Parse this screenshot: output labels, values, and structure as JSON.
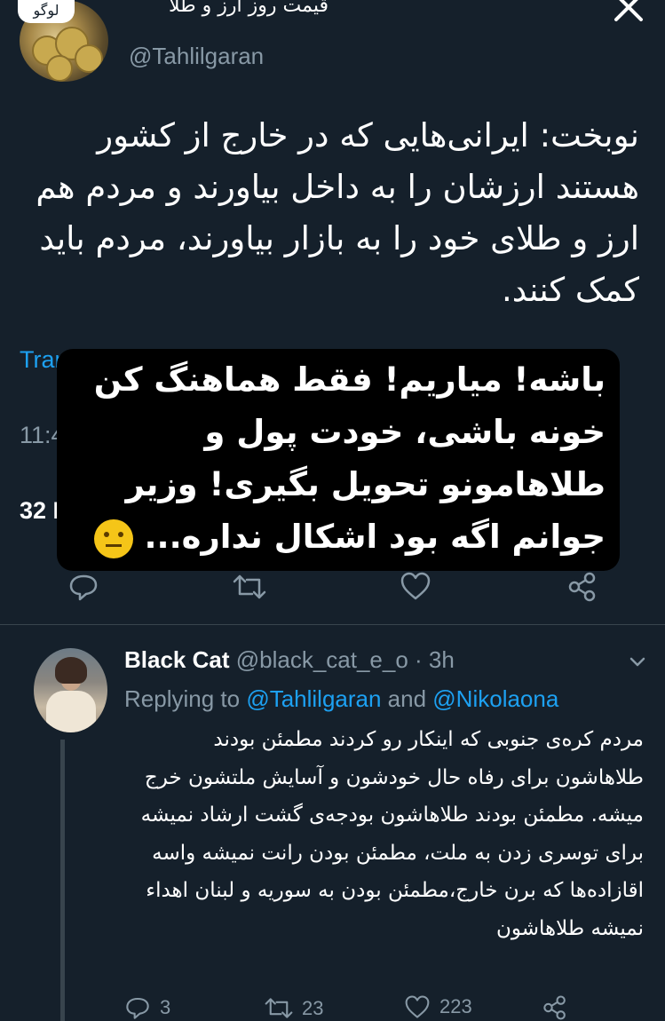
{
  "top_tweet": {
    "sticker": "لوگو",
    "display_name": "قیمت روز ارز و طلا",
    "handle": "@Tahlilgaran",
    "text": "نوبخت: ایرانی‌هایی که در خارج از کشور هستند ارزشان را به داخل بیاورند و مردم هم ارز و طلای خود را به بازار بیاورند، مردم باید کمک کنند.",
    "translate_label": "Tran",
    "time": "11:42 A",
    "retweets": "32 R"
  },
  "overlay_caption": {
    "line1": "باشه! میاریم! فقط هماهنگ کن",
    "line2": "خونه باشی، خودت پول و",
    "line3": "طلاهامونو تحویل بگیری! وزیر",
    "line4": "جوانم اگه بود اشکال نداره..."
  },
  "reply": {
    "display_name": "Black Cat",
    "handle": "@black_cat_e_o",
    "separator": " · ",
    "age": "3h",
    "replying_prefix": "Replying to ",
    "mention_1": "@Tahlilgaran",
    "and_word": " and ",
    "mention_2": "@Nikolaona",
    "text": "مردم کره‌ی جنوبی که اینکار رو کردند مطمئن بودند طلاهاشون برای رفاه حال خودشون و آسایش ملتشون خرج میشه. مطمئن بودند طلاهاشون بودجه‌ی گشت ارشاد نمیشه برای توسری زدن به ملت، مطمئن بودن رانت نمیشه واسه اقازاده‌ها که برن خارج،مطمئن بودن به سوریه و لبنان اهداء نمیشه طلاهاشون",
    "replies": "3",
    "retweets": "23",
    "likes": "223"
  },
  "colors": {
    "background": "#15202b",
    "link": "#1da1f2",
    "secondary_text": "#8899a6",
    "divider": "#38444d",
    "overlay": "#000000"
  },
  "icons": [
    "close-icon",
    "reply-icon",
    "retweet-icon",
    "like-icon",
    "share-icon",
    "chevron-down-icon",
    "neutral-face-emoji"
  ]
}
